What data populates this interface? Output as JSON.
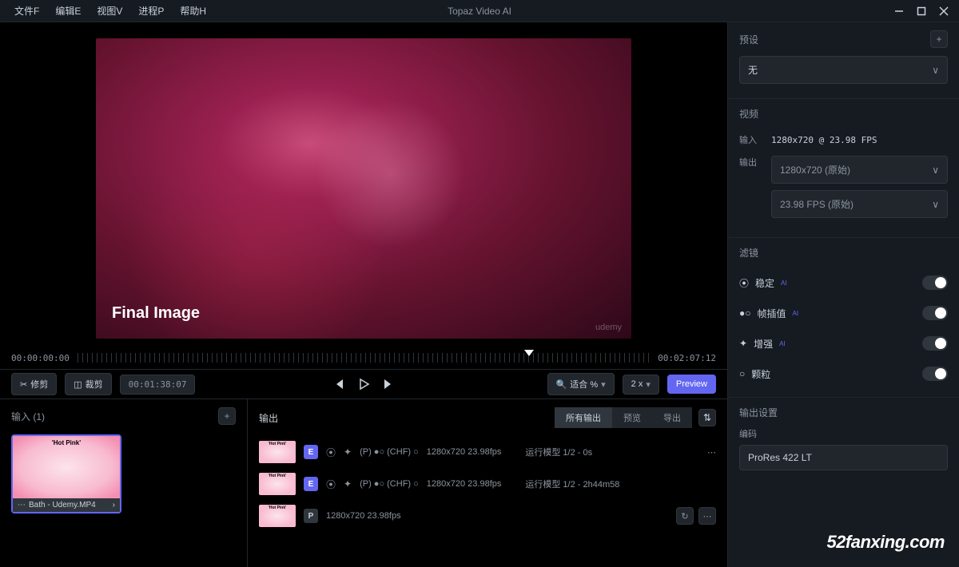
{
  "titlebar": {
    "menu": [
      "文件F",
      "编辑E",
      "视图V",
      "进程P",
      "帮助H"
    ],
    "app_title": "Topaz Video AI"
  },
  "preview": {
    "final_label": "Final Image",
    "watermark": "udemy"
  },
  "timeline": {
    "start": "00:00:00:00",
    "end": "00:02:07:12",
    "current": "00:01:38:07"
  },
  "controls": {
    "trim": "修剪",
    "crop": "裁剪",
    "fit": "适合 %",
    "zoom": "2 x",
    "preview_btn": "Preview"
  },
  "input_panel": {
    "title": "输入 (1)",
    "thumb_title": "'Hot Pink'",
    "thumb_name": "Bath - Udemy.MP4"
  },
  "output_panel": {
    "title": "输出",
    "tabs": [
      "所有输出",
      "预览",
      "导出"
    ],
    "rows": [
      {
        "badge": "E",
        "params": "(P) ●○ (CHF) ○",
        "res": "1280x720 23.98fps",
        "status": "运行模型 1/2 - 0s"
      },
      {
        "badge": "E",
        "params": "(P) ●○ (CHF) ○",
        "res": "1280x720 23.98fps",
        "status": "运行模型 1/2 - 2h44m58"
      },
      {
        "badge": "P",
        "params": "",
        "res": "1280x720 23.98fps",
        "status": ""
      }
    ]
  },
  "sidebar": {
    "preset_title": "预设",
    "preset_value": "无",
    "video_title": "视频",
    "input_label": "输入",
    "input_value": "1280x720 @ 23.98 FPS",
    "output_label": "输出",
    "output_res": "1280x720 (原始)",
    "output_fps": "23.98 FPS (原始)",
    "filters_title": "滤镜",
    "filters": [
      {
        "icon": "stabilize",
        "label": "稳定",
        "ai": true
      },
      {
        "icon": "interpolate",
        "label": "帧插值",
        "ai": true
      },
      {
        "icon": "enhance",
        "label": "增强",
        "ai": true
      },
      {
        "icon": "grain",
        "label": "颗粒",
        "ai": false
      }
    ],
    "output_settings_title": "输出设置",
    "encoder_label": "编码",
    "encoder_value": "ProRes 422 LT"
  },
  "watermark": "52fanxing.com"
}
